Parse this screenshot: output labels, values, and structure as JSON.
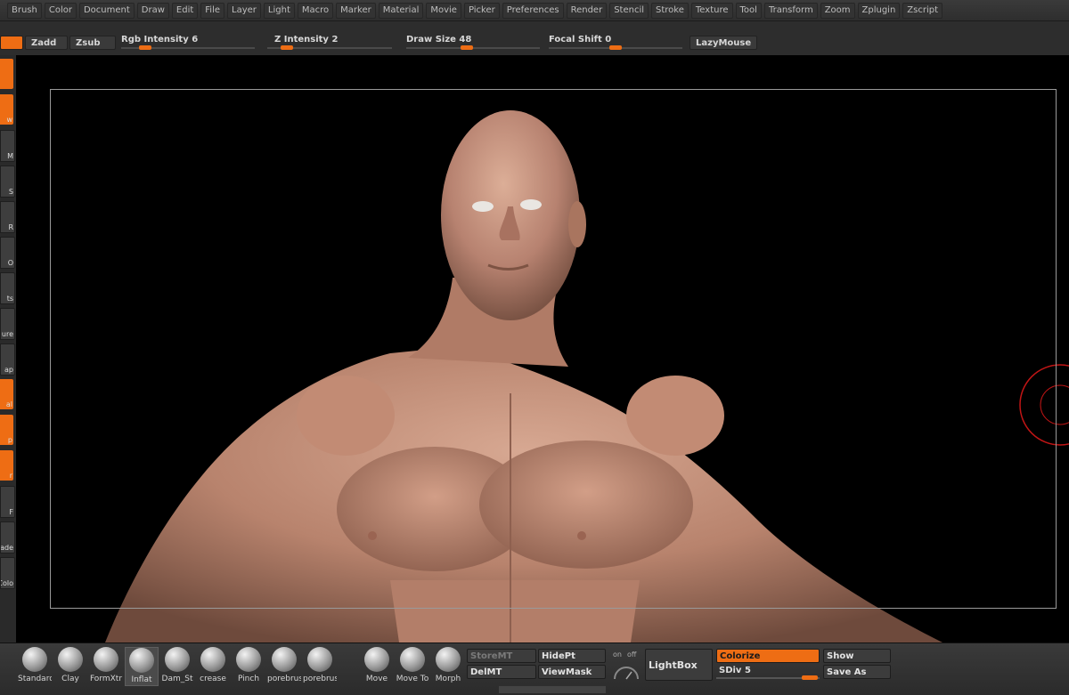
{
  "menu": [
    "Brush",
    "Color",
    "Document",
    "Draw",
    "Edit",
    "File",
    "Layer",
    "Light",
    "Macro",
    "Marker",
    "Material",
    "Movie",
    "Picker",
    "Preferences",
    "Render",
    "Stencil",
    "Stroke",
    "Texture",
    "Tool",
    "Transform",
    "Zoom",
    "Zplugin",
    "Zscript"
  ],
  "toolbar": {
    "zadd": "Zadd",
    "zsub": "Zsub",
    "rgb_label": "Rgb",
    "rgb_intensity_label": "Intensity",
    "rgb_intensity_value": "6",
    "rgb_intensity_level": 0.15,
    "z_label": "Z",
    "z_intensity_label": "Intensity",
    "z_intensity_value": "2",
    "z_intensity_level": 0.12,
    "draw_size_label": "Draw Size",
    "draw_size_value": "48",
    "draw_size_level": 0.45,
    "focal_shift_label": "Focal Shift",
    "focal_shift_value": "0",
    "focal_shift_level": 0.5,
    "lazymouse": "LazyMouse"
  },
  "left_tray": [
    {
      "caption": "",
      "state": "orange"
    },
    {
      "caption": "w",
      "state": "orange"
    },
    {
      "caption": "M",
      "state": "gray"
    },
    {
      "caption": "S",
      "state": "gray"
    },
    {
      "caption": "R",
      "state": "gray"
    },
    {
      "caption": "O",
      "state": "gray"
    },
    {
      "caption": "ts",
      "state": "gray"
    },
    {
      "caption": "ure",
      "state": "gray"
    },
    {
      "caption": "ap",
      "state": "gray"
    },
    {
      "caption": "al",
      "state": "orange"
    },
    {
      "caption": "p",
      "state": "orange"
    },
    {
      "caption": "r",
      "state": "orange"
    },
    {
      "caption": "F",
      "state": "gray"
    },
    {
      "caption": "hade",
      "state": "gray"
    },
    {
      "caption": "Colo",
      "state": "gray"
    }
  ],
  "brushes": [
    "Standard",
    "Clay",
    "FormXtr",
    "Inflat",
    "Dam_St",
    "crease",
    "Pinch",
    "porebrus",
    "porebrus"
  ],
  "transform_brushes": [
    "Move",
    "Move To",
    "Morph"
  ],
  "shelf": {
    "storemt": "StoreMT",
    "delmt": "DelMT",
    "hidept": "HidePt",
    "viewmask": "ViewMask",
    "on": "on",
    "off": "off",
    "lightbox": "LightBox",
    "colorize": "Colorize",
    "sdiv_label": "SDiv",
    "sdiv_value": "5",
    "show": "Show",
    "save_as": "Save As"
  },
  "colors": {
    "accent": "#ee6d14",
    "background": "#000000",
    "skin": "#b98873"
  }
}
